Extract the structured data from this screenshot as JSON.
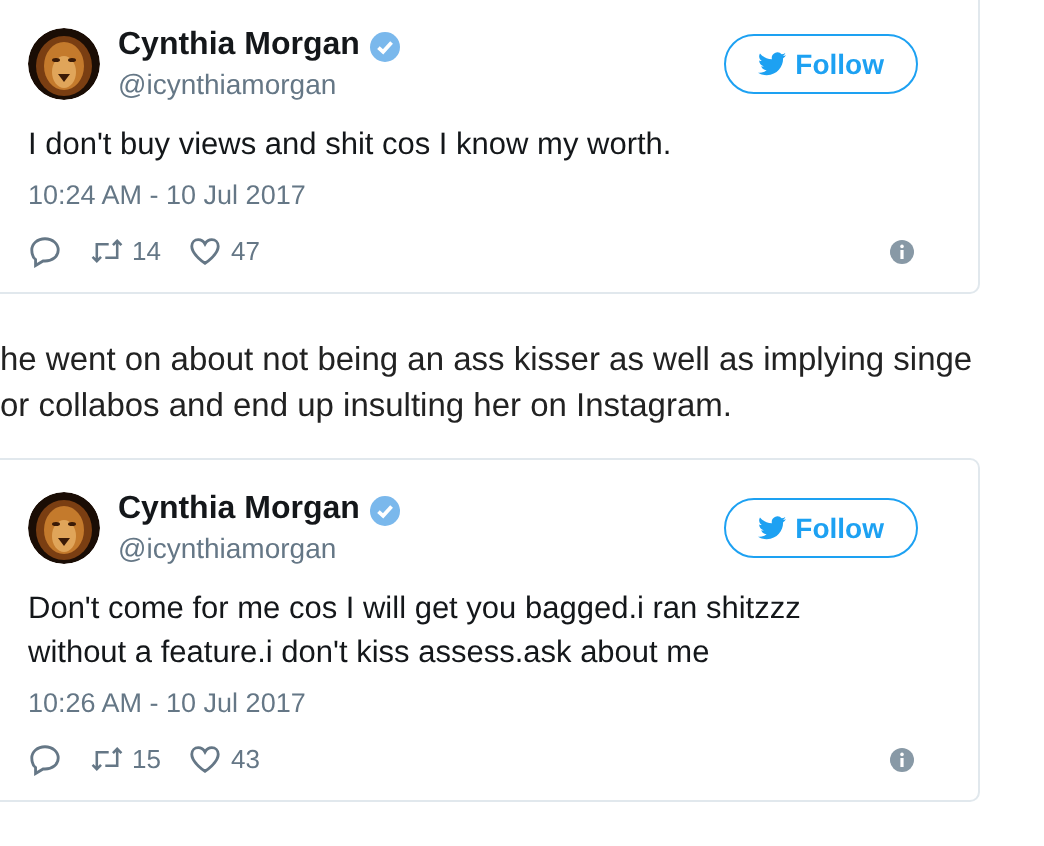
{
  "items": [
    {
      "kind": "tweet",
      "name": "Cynthia Morgan",
      "verified": true,
      "handle": "@icynthiamorgan",
      "follow": "Follow",
      "text": "I don't buy views and shit cos I know my worth.",
      "time": "10:24 AM - 10 Jul 2017",
      "retweets": "14",
      "likes": "47"
    },
    {
      "kind": "paragraph",
      "lines": [
        "he went on about not being an ass kisser as well as implying singe",
        "or collabos and end up insulting her on Instagram."
      ]
    },
    {
      "kind": "tweet",
      "name": "Cynthia Morgan",
      "verified": true,
      "handle": "@icynthiamorgan",
      "follow": "Follow",
      "text": "Don't come for me cos I will get you bagged.i ran shitzzz without a feature.i don't kiss assess.ask about me",
      "time": "10:26 AM - 10 Jul 2017",
      "retweets": "15",
      "likes": "43"
    }
  ]
}
